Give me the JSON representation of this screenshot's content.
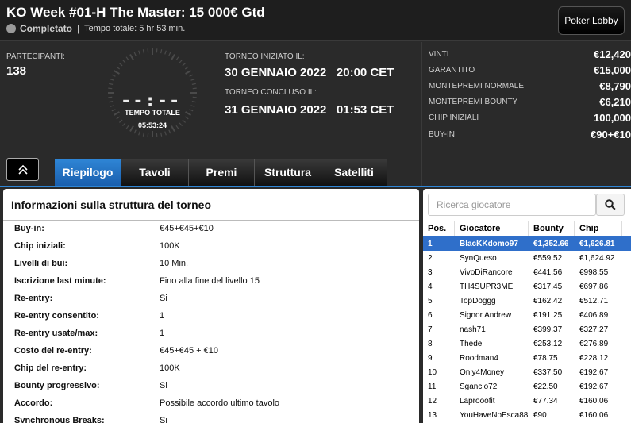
{
  "header": {
    "title": "KO Week #01-H The Master: 15 000€ Gtd",
    "status": "Completato",
    "total_time": "Tempo totale: 5 hr 53 min.",
    "lobby_button": "Poker Lobby"
  },
  "info": {
    "participants_label": "PARTECIPANTI:",
    "participants_value": "138",
    "clock_digits": "--:--",
    "clock_label": "TEMPO TOTALE",
    "clock_value": "05:53:24",
    "started_label": "TORNEO INIZIATO IL:",
    "started_value": "30 GENNAIO 2022   20:00 CET",
    "ended_label": "TORNEO CONCLUSO IL:",
    "ended_value": "31 GENNAIO 2022   01:53 CET"
  },
  "tabs": [
    {
      "label": "Riepilogo",
      "active": true
    },
    {
      "label": "Tavoli",
      "active": false
    },
    {
      "label": "Premi",
      "active": false
    },
    {
      "label": "Struttura",
      "active": false
    },
    {
      "label": "Satelliti",
      "active": false
    }
  ],
  "stats": [
    {
      "label": "VINTI",
      "value": "€12,420"
    },
    {
      "label": "GARANTITO",
      "value": "€15,000"
    },
    {
      "label": "MONTEPREMI NORMALE",
      "value": "€8,790"
    },
    {
      "label": "MONTEPREMI BOUNTY",
      "value": "€6,210"
    },
    {
      "label": "CHIP INIZIALI",
      "value": "100,000"
    },
    {
      "label": "BUY-IN",
      "value": "€90+€10"
    }
  ],
  "structure": {
    "title": "Informazioni sulla struttura del torneo",
    "rows": [
      {
        "key": "Buy-in:",
        "value": "€45+€45+€10"
      },
      {
        "key": "Chip iniziali:",
        "value": "100K"
      },
      {
        "key": "Livelli di bui:",
        "value": "10 Min."
      },
      {
        "key": "Iscrizione last minute:",
        "value": "Fino alla fine del livello 15"
      },
      {
        "key": "Re-entry:",
        "value": "Si"
      },
      {
        "key": "Re-entry consentito:",
        "value": "1"
      },
      {
        "key": "Re-entry usate/max:",
        "value": "1"
      },
      {
        "key": "Costo del re-entry:",
        "value": "€45+€45 + €10"
      },
      {
        "key": "Chip del re-entry:",
        "value": "100K"
      },
      {
        "key": "Bounty progressivo:",
        "value": "Si"
      },
      {
        "key": "Accordo:",
        "value": "Possibile accordo ultimo tavolo"
      },
      {
        "key": "Synchronous Breaks:",
        "value": "Si"
      }
    ]
  },
  "leaderboard": {
    "search_placeholder": "Ricerca giocatore",
    "columns": [
      "Pos.",
      "Giocatore",
      "Bounty",
      "Chip"
    ],
    "rows": [
      {
        "pos": "1",
        "name": "BlacKKdomo97",
        "bounty": "€1,352.66",
        "chip": "€1,626.81"
      },
      {
        "pos": "2",
        "name": "SynQueso",
        "bounty": "€559.52",
        "chip": "€1,624.92"
      },
      {
        "pos": "3",
        "name": "VivoDiRancore",
        "bounty": "€441.56",
        "chip": "€998.55"
      },
      {
        "pos": "4",
        "name": "TH4SUPR3ME",
        "bounty": "€317.45",
        "chip": "€697.86"
      },
      {
        "pos": "5",
        "name": "TopDoggg",
        "bounty": "€162.42",
        "chip": "€512.71"
      },
      {
        "pos": "6",
        "name": "Signor Andrew",
        "bounty": "€191.25",
        "chip": "€406.89"
      },
      {
        "pos": "7",
        "name": "nash71",
        "bounty": "€399.37",
        "chip": "€327.27"
      },
      {
        "pos": "8",
        "name": "Thede",
        "bounty": "€253.12",
        "chip": "€276.89"
      },
      {
        "pos": "9",
        "name": "Roodman4",
        "bounty": "€78.75",
        "chip": "€228.12"
      },
      {
        "pos": "10",
        "name": "Only4Money",
        "bounty": "€337.50",
        "chip": "€192.67"
      },
      {
        "pos": "11",
        "name": "Sgancio72",
        "bounty": "€22.50",
        "chip": "€192.67"
      },
      {
        "pos": "12",
        "name": "Laprooofit",
        "bounty": "€77.34",
        "chip": "€160.06"
      },
      {
        "pos": "13",
        "name": "YouHaveNoEsca88",
        "bounty": "€90",
        "chip": "€160.06"
      }
    ]
  }
}
